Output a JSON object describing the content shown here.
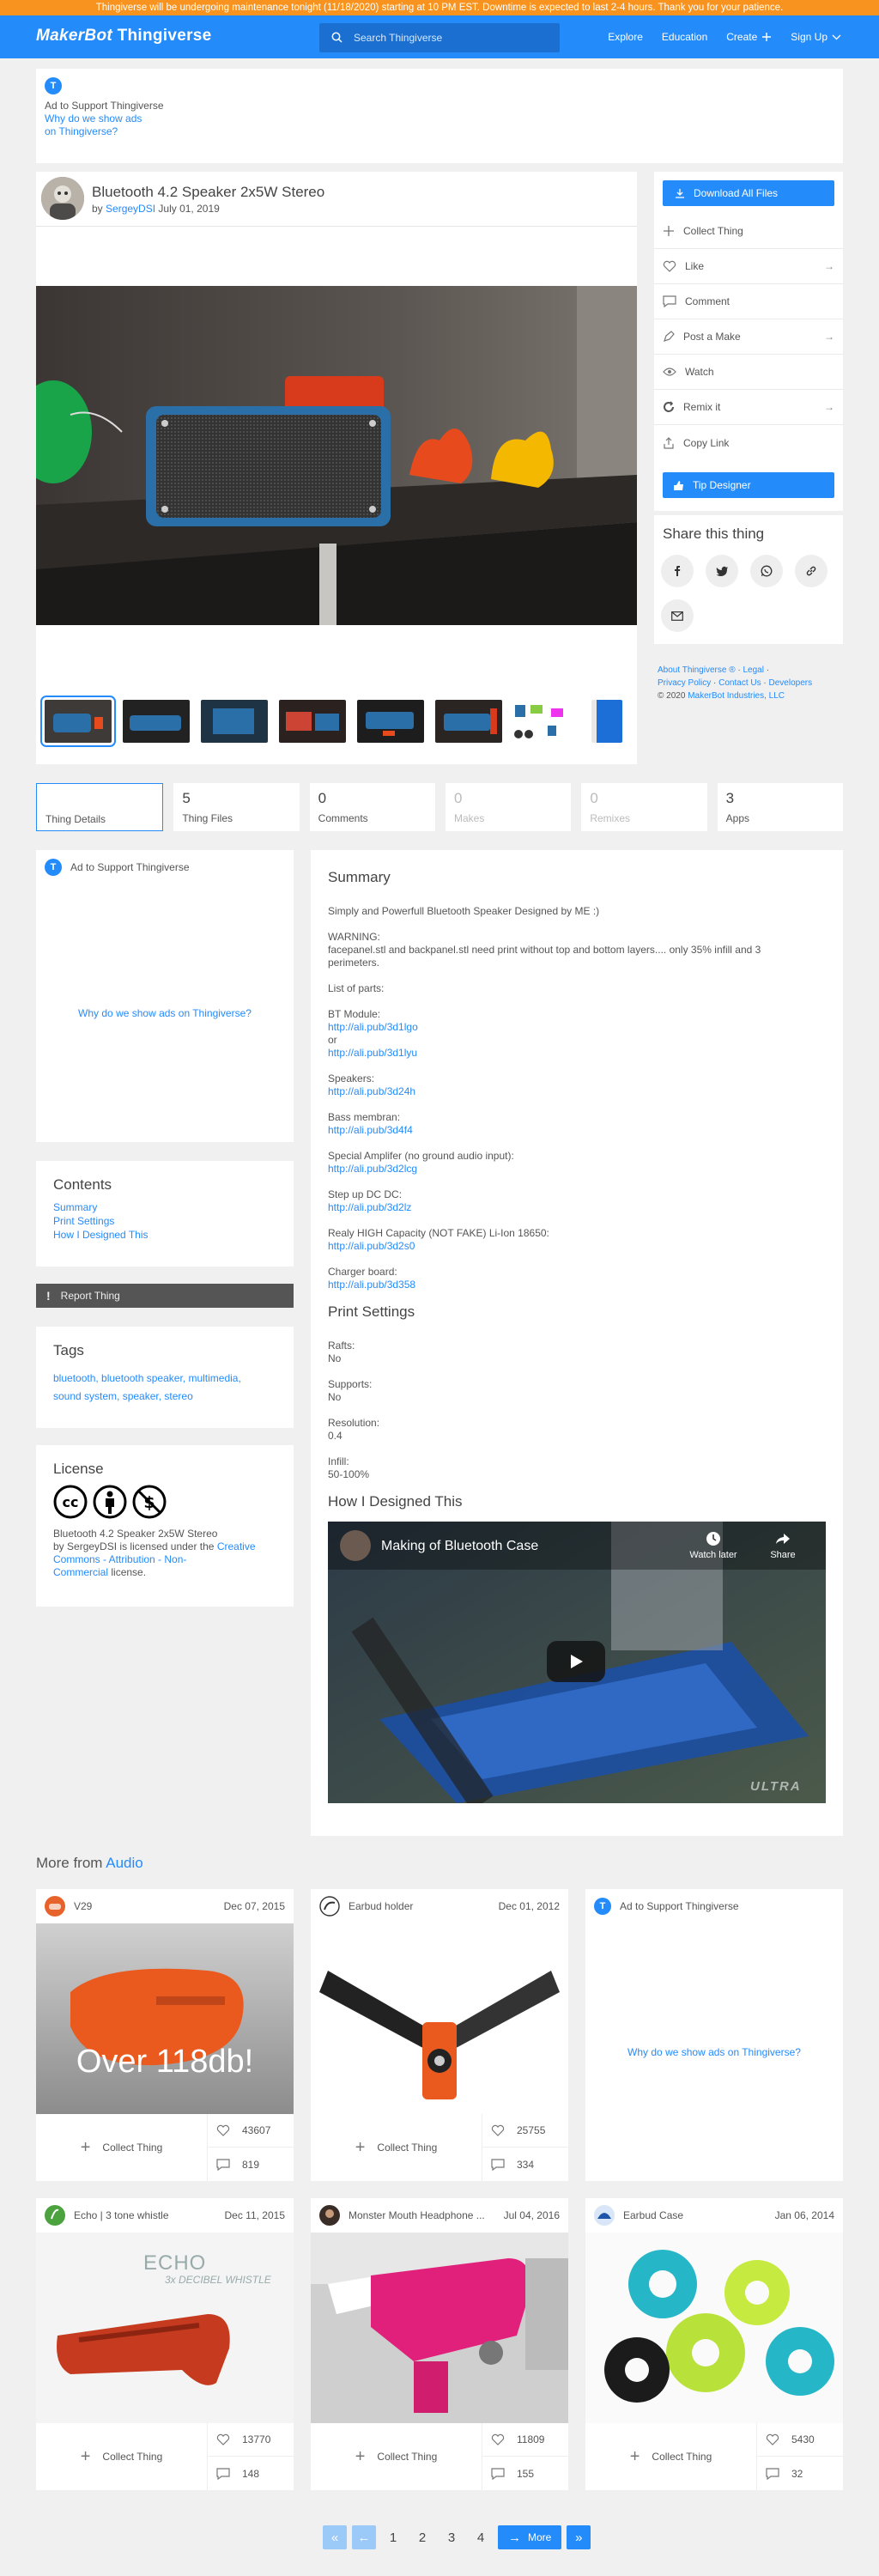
{
  "banner": "Thingiverse will be undergoing maintenance tonight (11/18/2020) starting at 10 PM EST. Downtime is expected to last 2-4 hours. Thank you for your patience.",
  "nav": {
    "logo_brand": "MakerBot",
    "logo_product": "Thingiverse",
    "search_placeholder": "Search Thingiverse",
    "links": [
      "Explore",
      "Education",
      "Create",
      "Sign Up"
    ]
  },
  "top_ad": {
    "logo": "T",
    "title": "Ad to Support Thingiverse",
    "why_line1": "Why do we show ads",
    "why_line2": "on Thingiverse?"
  },
  "thing": {
    "title": "Bluetooth 4.2 Speaker 2x5W Stereo",
    "by": "by",
    "author": "SergeyDSI",
    "date": "July 01, 2019"
  },
  "sidebar": {
    "download": "Download All Files",
    "items": [
      {
        "label": "Collect Thing",
        "icon": "plus-icon",
        "arrow": false
      },
      {
        "label": "Like",
        "icon": "heart-icon",
        "arrow": true
      },
      {
        "label": "Comment",
        "icon": "comment-icon",
        "arrow": false
      },
      {
        "label": "Post a Make",
        "icon": "pen-icon",
        "arrow": true
      },
      {
        "label": "Watch",
        "icon": "eye-icon",
        "arrow": false
      },
      {
        "label": "Remix it",
        "icon": "remix-icon",
        "arrow": true
      },
      {
        "label": "Copy Link",
        "icon": "share-icon",
        "arrow": false
      }
    ],
    "tip": "Tip Designer"
  },
  "share": {
    "title": "Share this thing"
  },
  "footer_links": {
    "about": "About Thingiverse ®",
    "legal": "Legal",
    "privacy": "Privacy Policy",
    "contact": "Contact Us",
    "developers": "Developers",
    "copyright": "© 2020",
    "company": "MakerBot Industries, LLC"
  },
  "tabs": [
    {
      "count": "",
      "label": "Thing Details"
    },
    {
      "count": "5",
      "label": "Thing Files"
    },
    {
      "count": "0",
      "label": "Comments"
    },
    {
      "count": "0",
      "label": "Makes"
    },
    {
      "count": "0",
      "label": "Remixes"
    },
    {
      "count": "3",
      "label": "Apps"
    }
  ],
  "side_ad": {
    "logo": "T",
    "title": "Ad to Support Thingiverse",
    "why": "Why do we show ads on Thingiverse?"
  },
  "contents": {
    "title": "Contents",
    "links": [
      "Summary",
      "Print Settings",
      "How I Designed This"
    ]
  },
  "report": "Report Thing",
  "tags": {
    "title": "Tags",
    "line1": "bluetooth, bluetooth speaker, multimedia,",
    "line2": "sound system, speaker, stereo"
  },
  "license": {
    "title": "License",
    "thing": "Bluetooth 4.2 Speaker 2x5W Stereo",
    "by": "by",
    "author": "SergeyDSI",
    "is_licensed": "is licensed under the",
    "cc1": "Creative",
    "cc2": "Commons - Attribution - Non-",
    "cc3": "Commercial",
    "end": "license."
  },
  "summary": {
    "title": "Summary",
    "intro": "Simply and Powerfull Bluetooth Speaker Designed by ME :)",
    "warning_label": "WARNING:",
    "warning_line1": "facepanel.stl and backpanel.stl need print without top and bottom layers.... only 35% infill and 3",
    "warning_line2": "perimeters.",
    "list": "List of parts:",
    "bt": "BT Module:",
    "bt_link1": "http://ali.pub/3d1lgo",
    "or": "or",
    "bt_link2": "http://ali.pub/3d1lyu",
    "speakers": "Speakers:",
    "speakers_link": "http://ali.pub/3d24h",
    "bass": "Bass membran:",
    "bass_link": "http://ali.pub/3d4f4",
    "amp": "Special Amplifer (no ground audio input):",
    "amp_link": "http://ali.pub/3d2lcg",
    "dcdc": "Step up DC DC:",
    "dcdc_link": "http://ali.pub/3d2lz",
    "battery": "Realy HIGH Capacity (NOT FAKE) Li-Ion 18650:",
    "battery_link": "http://ali.pub/3d2s0",
    "charger": "Charger board:",
    "charger_link": "http://ali.pub/3d358"
  },
  "print_settings": {
    "title": "Print Settings",
    "rafts_label": "Rafts:",
    "rafts": "No",
    "supports_label": "Supports:",
    "supports": "No",
    "resolution_label": "Resolution:",
    "resolution": "0.4",
    "infill_label": "Infill:",
    "infill": "50-100%"
  },
  "designed": {
    "title": "How I Designed This",
    "video_title": "Making of Bluetooth Case",
    "watch_later": "Watch later",
    "share": "Share",
    "watermark": "ULTRA"
  },
  "more": {
    "prefix": "More from",
    "category": "Audio"
  },
  "products": [
    {
      "name": "V29",
      "date": "Dec 07, 2015",
      "likes": "43607",
      "comments": "819",
      "overlay": "Over 118db!",
      "collect": "Collect Thing"
    },
    {
      "name": "Earbud holder",
      "date": "Dec 01, 2012",
      "likes": "25755",
      "comments": "334",
      "collect": "Collect Thing"
    },
    {
      "name": "Echo | 3 tone whistle",
      "date": "Dec 11, 2015",
      "likes": "13770",
      "comments": "148",
      "overlay1": "ECHO",
      "overlay2": "3x DECIBEL WHISTLE",
      "collect": "Collect Thing"
    },
    {
      "name": "Monster Mouth Headphone ...",
      "date": "Jul 04, 2016",
      "likes": "11809",
      "comments": "155",
      "collect": "Collect Thing"
    },
    {
      "name": "Earbud Case",
      "date": "Jan 06, 2014",
      "likes": "5430",
      "comments": "32",
      "collect": "Collect Thing"
    }
  ],
  "product_ad": {
    "logo": "T",
    "title": "Ad to Support Thingiverse",
    "why": "Why do we show ads on Thingiverse?"
  },
  "pager": {
    "pages": [
      "1",
      "2",
      "3",
      "4"
    ],
    "more": "More"
  },
  "colors": {
    "accent": "#248bfb",
    "banner": "#f7931e"
  }
}
